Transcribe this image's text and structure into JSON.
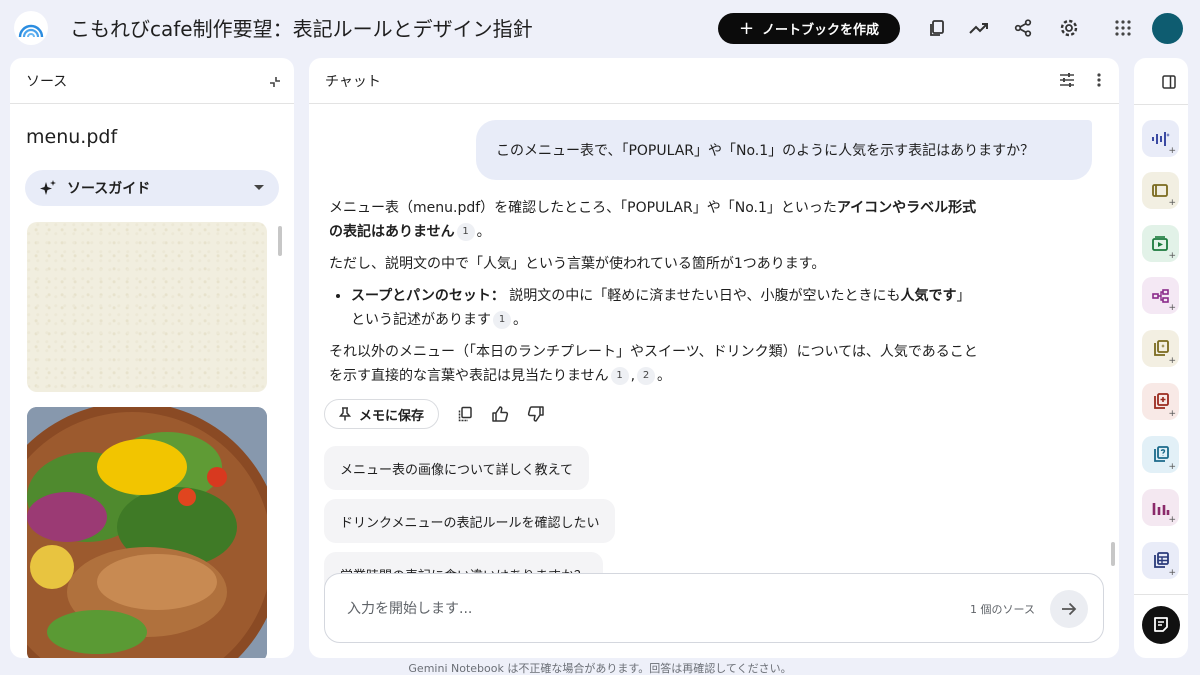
{
  "header": {
    "title": "こもれびcafe制作要望：表記ルールとデザイン指針",
    "create_button": "ノートブックを作成",
    "create_plus": "+"
  },
  "sources": {
    "heading": "ソース",
    "file_name": "menu.pdf",
    "guide_label": "ソースガイド"
  },
  "chat": {
    "heading": "チャット",
    "user_message": "このメニュー表で、「POPULAR」や「No.1」のように人気を示す表記はありますか？",
    "answer": {
      "p1_a": "メニュー表（menu.pdf）を確認したところ、「POPULAR」や「No.1」といった",
      "p1_bold": "アイコンやラベル形式の表記はありません",
      "p1_cite": "1",
      "p1_end": "。",
      "p2": "ただし、説明文の中で「人気」という言葉が使われている箇所が1つあります。",
      "li_bold": "スープとパンのセット：",
      "li_text": " 説明文の中に「軽めに済ませたい日や、小腹が空いたときにも",
      "li_bold2": "人気です",
      "li_text2": "」という記述があります",
      "li_cite": "1",
      "li_end": "。",
      "p3": "それ以外のメニュー（「本日のランチプレート」やスイーツ、ドリンク類）については、人気であることを示す直接的な言葉や表記は見当たりません",
      "p3_cite1": "1",
      "p3_sep": ",",
      "p3_cite2": "2",
      "p3_end": "。"
    },
    "save_memo": "メモに保存",
    "suggestions": [
      "メニュー表の画像について詳しく教えて",
      "ドリンクメニューの表記ルールを確認したい",
      "営業時間の表記に食い違いはありますか？"
    ],
    "input_placeholder": "入力を開始します...",
    "source_count": "1 個のソース"
  },
  "footer": "Gemini Notebook は不正確な場合があります。回答は再確認してください。",
  "colors": {
    "background": "#eef0f9",
    "primary_button": "#0b0b0b",
    "avatar": "#0e5c70",
    "user_bubble": "#e8ecf8"
  }
}
